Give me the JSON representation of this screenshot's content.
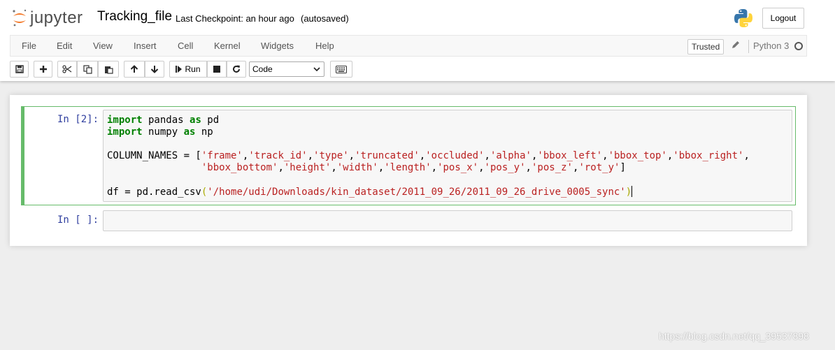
{
  "header": {
    "logo_text": "jupyter",
    "notebook_name": "Tracking_file",
    "checkpoint": "Last Checkpoint: an hour ago",
    "autosave": "(autosaved)",
    "logout_label": "Logout"
  },
  "menubar": {
    "items": [
      "File",
      "Edit",
      "View",
      "Insert",
      "Cell",
      "Kernel",
      "Widgets",
      "Help"
    ],
    "trusted_label": "Trusted",
    "kernel_name": "Python 3"
  },
  "toolbar": {
    "run_label": "Run",
    "cell_type": "Code",
    "cell_type_options": [
      "Code"
    ]
  },
  "cells": [
    {
      "prompt": "In [2]:",
      "code_lines": [
        "import pandas as pd",
        "import numpy as np",
        "",
        "COLUMN_NAMES = ['frame','track_id','type','truncated','occluded','alpha','bbox_left','bbox_top','bbox_right',",
        "                'bbox_bottom','height','width','length','pos_x','pos_y','pos_z','rot_y']",
        "",
        "df = pd.read_csv('/home/udi/Downloads/kin_dataset/2011_09_26/2011_09_26_drive_0005_sync')"
      ]
    },
    {
      "prompt": "In [ ]:",
      "code_lines": []
    }
  ],
  "watermark": "https://blog.csdn.net/qq_39537898",
  "colors": {
    "prompt": "#303f9f",
    "keyword": "#008000",
    "string": "#ba2121",
    "selected_cell_border": "#66bb6a"
  }
}
